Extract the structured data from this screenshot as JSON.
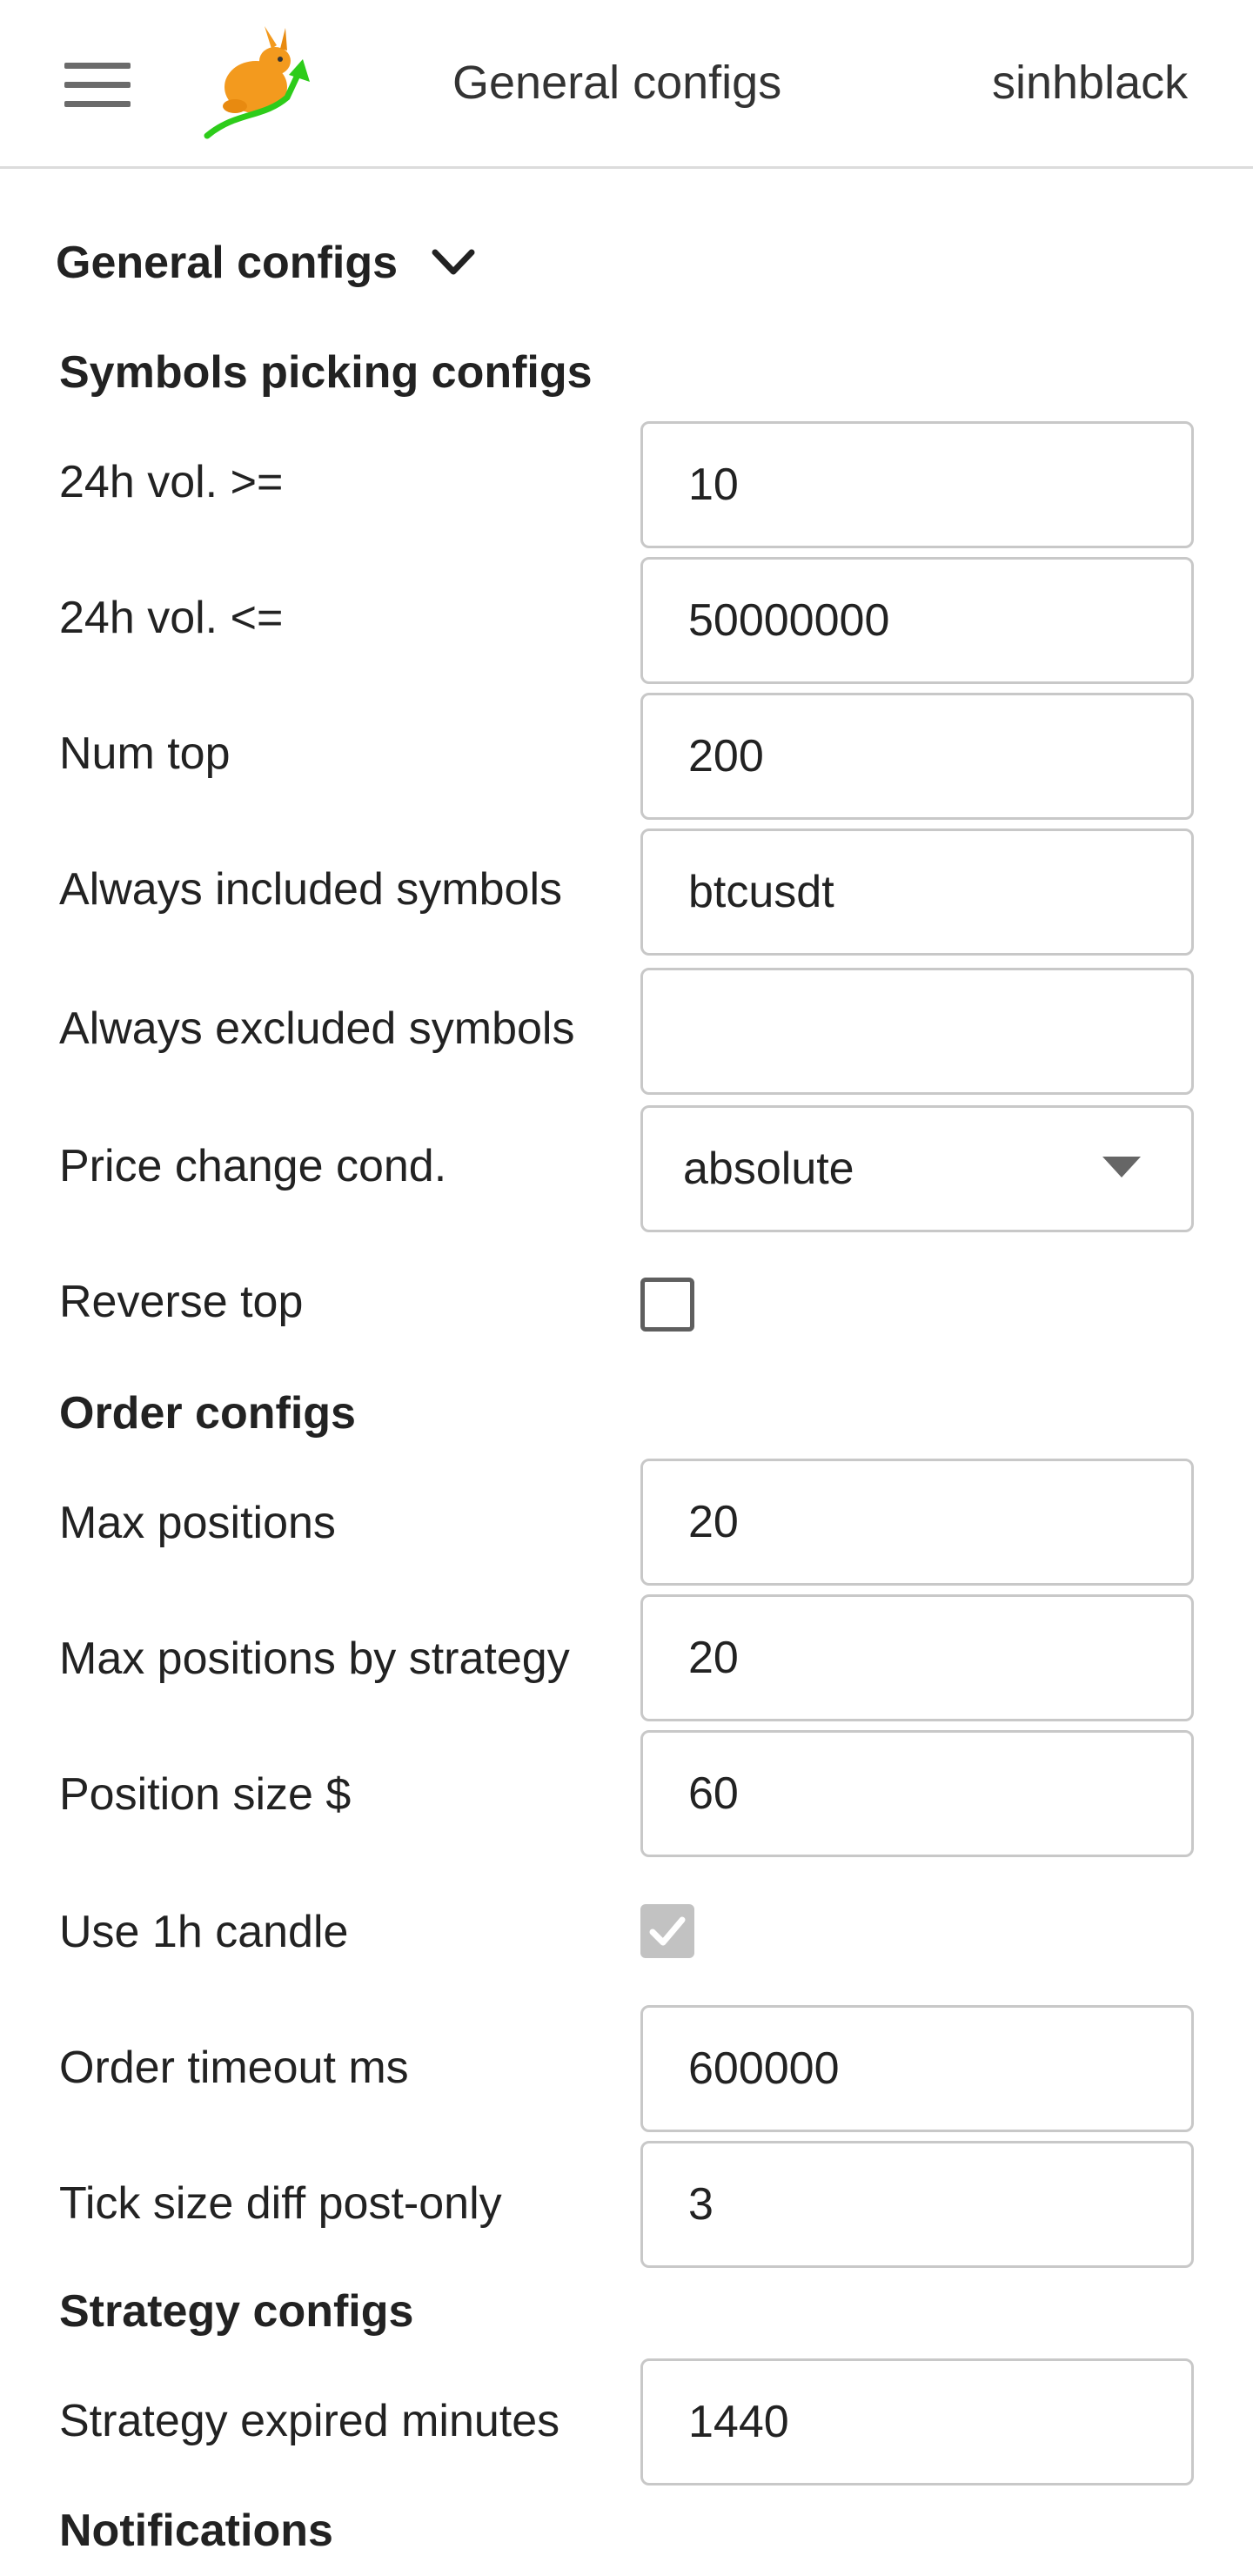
{
  "header": {
    "title": "General configs",
    "user": "sinhblack",
    "menu_icon": "hamburger-menu-icon",
    "logo_icon": "rabbit-logo-icon"
  },
  "section": {
    "title": "General configs",
    "toggle_icon": "chevron-down-icon"
  },
  "symbols_picking": {
    "heading": "Symbols picking configs",
    "vol_min": {
      "label": "24h vol. >=",
      "value": "10"
    },
    "vol_max": {
      "label": "24h vol. <=",
      "value": "50000000"
    },
    "num_top": {
      "label": "Num top",
      "value": "200"
    },
    "always_included": {
      "label": "Always included symbols",
      "value": "btcusdt"
    },
    "always_excluded": {
      "label": "Always excluded symbols",
      "value": ""
    },
    "price_change_cond": {
      "label": "Price change cond.",
      "value": "absolute"
    },
    "reverse_top": {
      "label": "Reverse top",
      "checked": false
    }
  },
  "order": {
    "heading": "Order configs",
    "max_positions": {
      "label": "Max positions",
      "value": "20"
    },
    "max_positions_by_strategy": {
      "label": "Max positions by strategy",
      "value": "20"
    },
    "position_size": {
      "label": "Position size $",
      "value": "60"
    },
    "use_1h_candle": {
      "label": "Use 1h candle",
      "checked": true
    },
    "order_timeout": {
      "label": "Order timeout ms",
      "value": "600000"
    },
    "tick_size_diff": {
      "label": "Tick size diff post-only",
      "value": "3"
    }
  },
  "strategy": {
    "heading": "Strategy configs",
    "expired_minutes": {
      "label": "Strategy expired minutes",
      "value": "1440"
    }
  },
  "notifications": {
    "heading": "Notifications"
  },
  "colors": {
    "logo_orange": "#f39a1e",
    "logo_green": "#2dcc1a",
    "input_border": "#c8c8c8",
    "disabled_checkbox": "#c2c2c2"
  }
}
